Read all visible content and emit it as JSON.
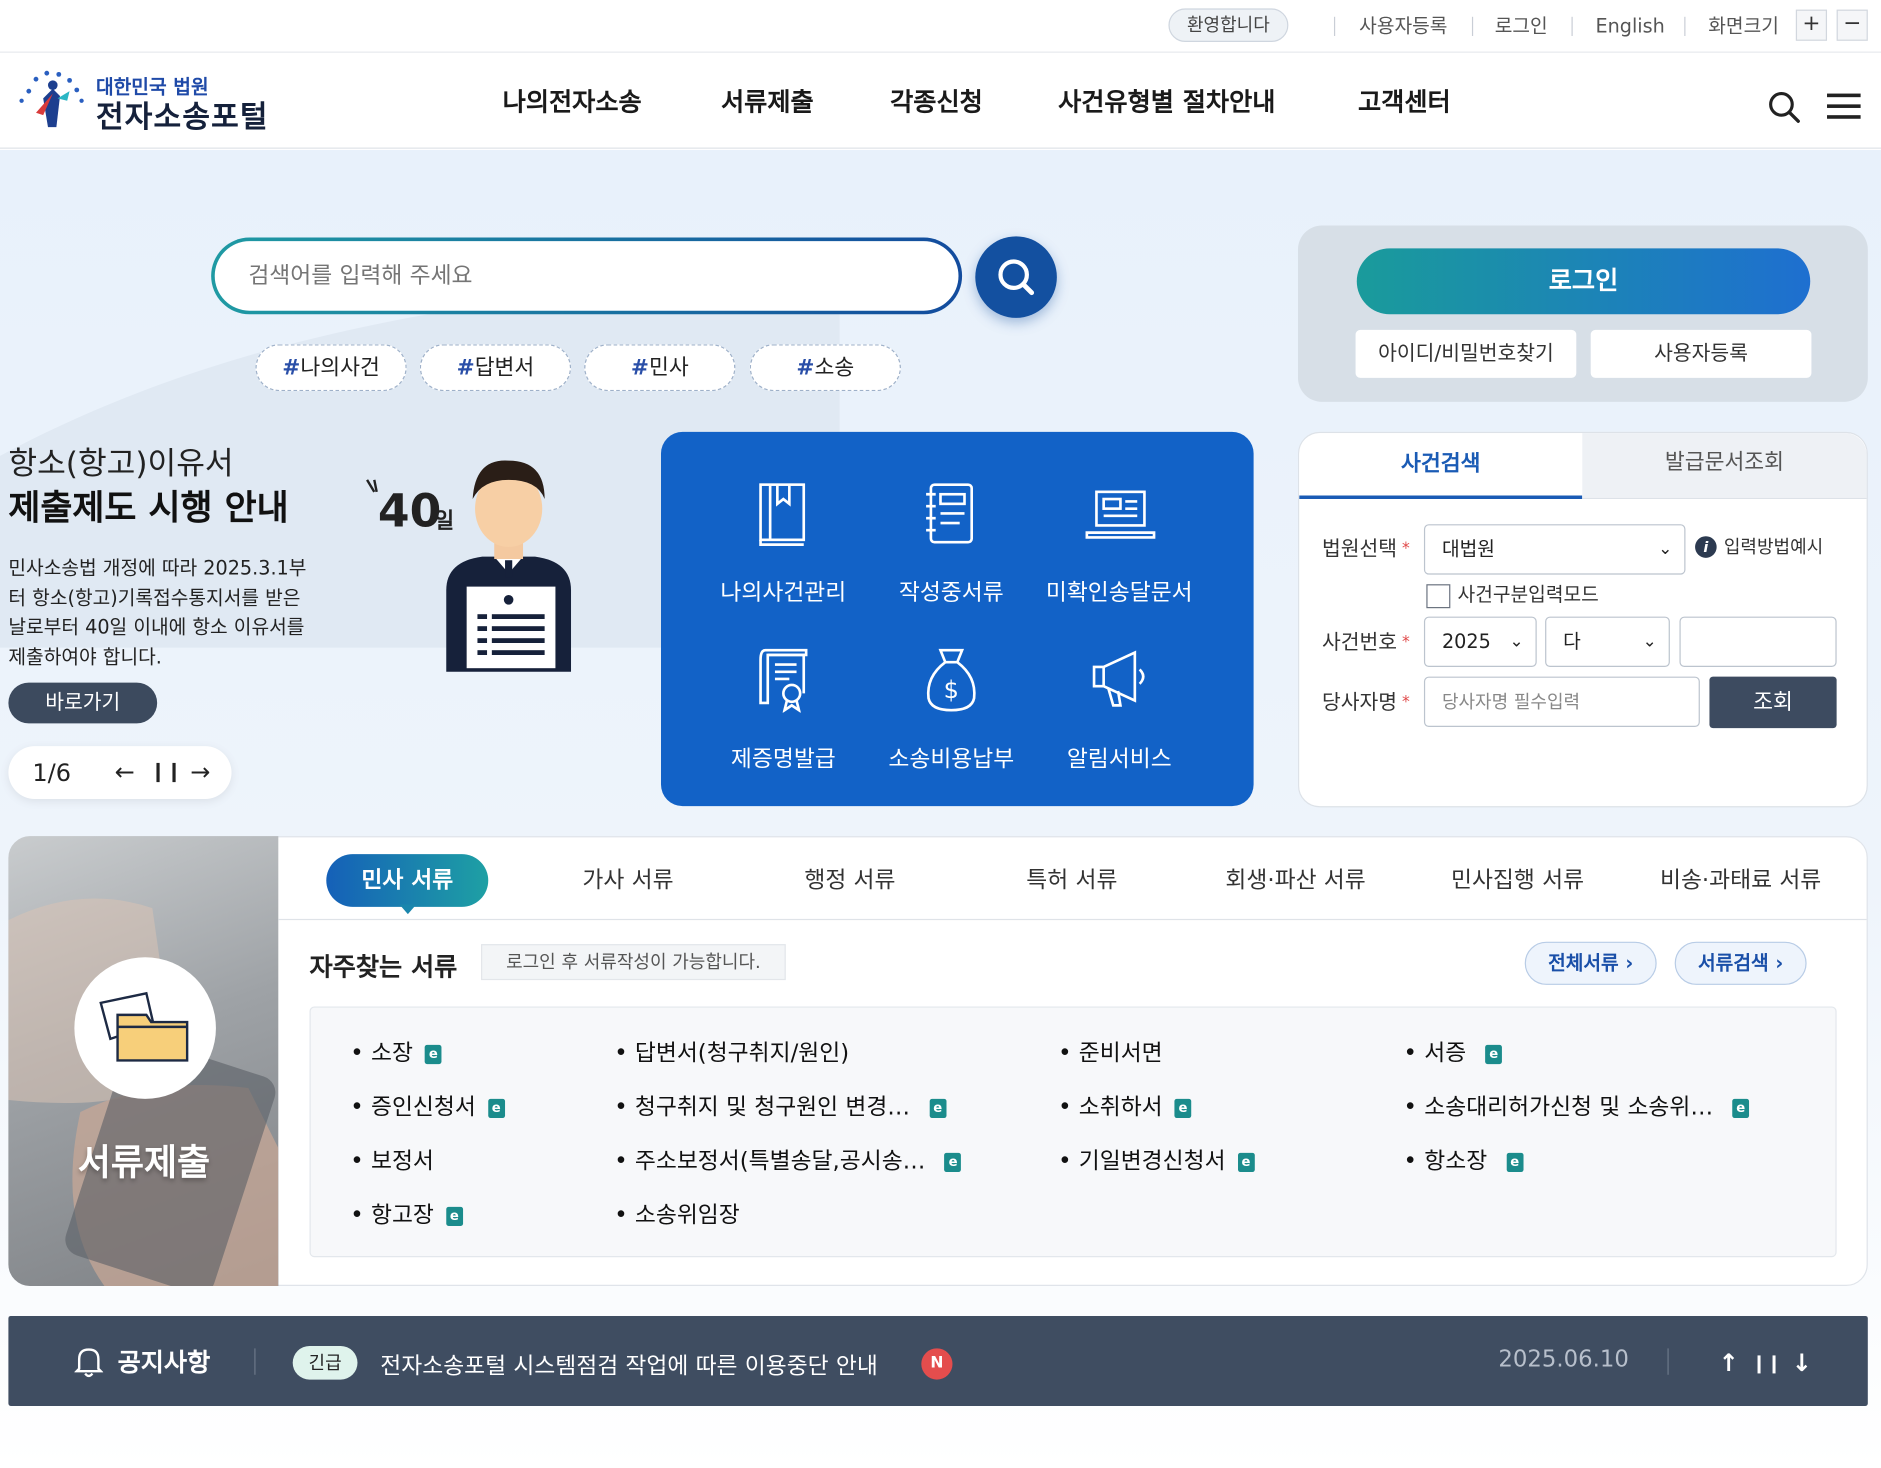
{
  "util": {
    "welcome": "환영합니다",
    "links": [
      "사용자등록",
      "로그인",
      "English",
      "화면크기"
    ],
    "zoom_in": "+",
    "zoom_out": "−"
  },
  "logo": {
    "small": "대한민국 법원",
    "big": "전자소송포털"
  },
  "nav": [
    "나의전자소송",
    "서류제출",
    "각종신청",
    "사건유형별 절차안내",
    "고객센터"
  ],
  "search": {
    "placeholder": "검색어를 입력해 주세요",
    "tags": [
      "나의사건",
      "답변서",
      "민사",
      "소송"
    ]
  },
  "login": {
    "button": "로그인",
    "find": "아이디/비밀번호찾기",
    "register": "사용자등록"
  },
  "banner": {
    "title_line1": "항소(항고)이유서",
    "title_line2": "제출제도 시행 안내",
    "desc": "민사소송법 개정에 따라 2025.3.1부터 항소(항고)기록접수통지서를 받은 날로부터 40일 이내에 항소 이유서를 제출하여야 합니다.",
    "go": "바로가기",
    "badge_num": "40",
    "badge_unit": "일",
    "pager": "1/6"
  },
  "quick": [
    {
      "label": "나의사건관리",
      "icon": "book-icon"
    },
    {
      "label": "작성중서류",
      "icon": "notebook-icon"
    },
    {
      "label": "미확인송달문서",
      "icon": "laptop-icon"
    },
    {
      "label": "제증명발급",
      "icon": "certificate-icon"
    },
    {
      "label": "소송비용납부",
      "icon": "money-bag-icon"
    },
    {
      "label": "알림서비스",
      "icon": "megaphone-icon"
    }
  ],
  "case_search": {
    "tab_active": "사건검색",
    "tab_other": "발급문서조회",
    "court_label": "법원선택",
    "court_value": "대법원",
    "help": "입력방법예시",
    "mode_label": "사건구분입력모드",
    "case_no_label": "사건번호",
    "year": "2025",
    "type": "다",
    "party_label": "당사자명",
    "party_placeholder": "당사자명 필수입력",
    "query": "조회"
  },
  "docs": {
    "side_label": "서류제출",
    "tabs": [
      "민사 서류",
      "가사 서류",
      "행정 서류",
      "특허 서류",
      "회생·파산 서류",
      "민사집행 서류",
      "비송·과태료 서류"
    ],
    "fav_title": "자주찾는 서류",
    "fav_note": "로그인 후 서류작성이 가능합니다.",
    "all": "전체서류",
    "find": "서류검색",
    "items": [
      {
        "text": "소장",
        "e": true
      },
      {
        "text": "답변서(청구취지/원인)",
        "e": false
      },
      {
        "text": "준비서면",
        "e": false
      },
      {
        "text": "서증",
        "e": true
      },
      {
        "text": "증인신청서",
        "e": true
      },
      {
        "text": "청구취지 및 청구원인 변경…",
        "e": true
      },
      {
        "text": "소취하서",
        "e": true
      },
      {
        "text": "소송대리허가신청 및 소송위…",
        "e": true
      },
      {
        "text": "보정서",
        "e": false
      },
      {
        "text": "주소보정서(특별송달,공시송…",
        "e": true
      },
      {
        "text": "기일변경신청서",
        "e": true
      },
      {
        "text": "항소장",
        "e": true
      },
      {
        "text": "항고장",
        "e": true
      },
      {
        "text": "소송위임장",
        "e": false
      }
    ]
  },
  "notice": {
    "title": "공지사항",
    "badge": "긴급",
    "text": "전자소송포털 시스템점검 작업에 따른 이용중단 안내",
    "new": "N",
    "date": "2025.06.10"
  },
  "colors": {
    "primary": "#1262c7",
    "navy": "#3f4d61",
    "teal": "#1a9b9b"
  }
}
